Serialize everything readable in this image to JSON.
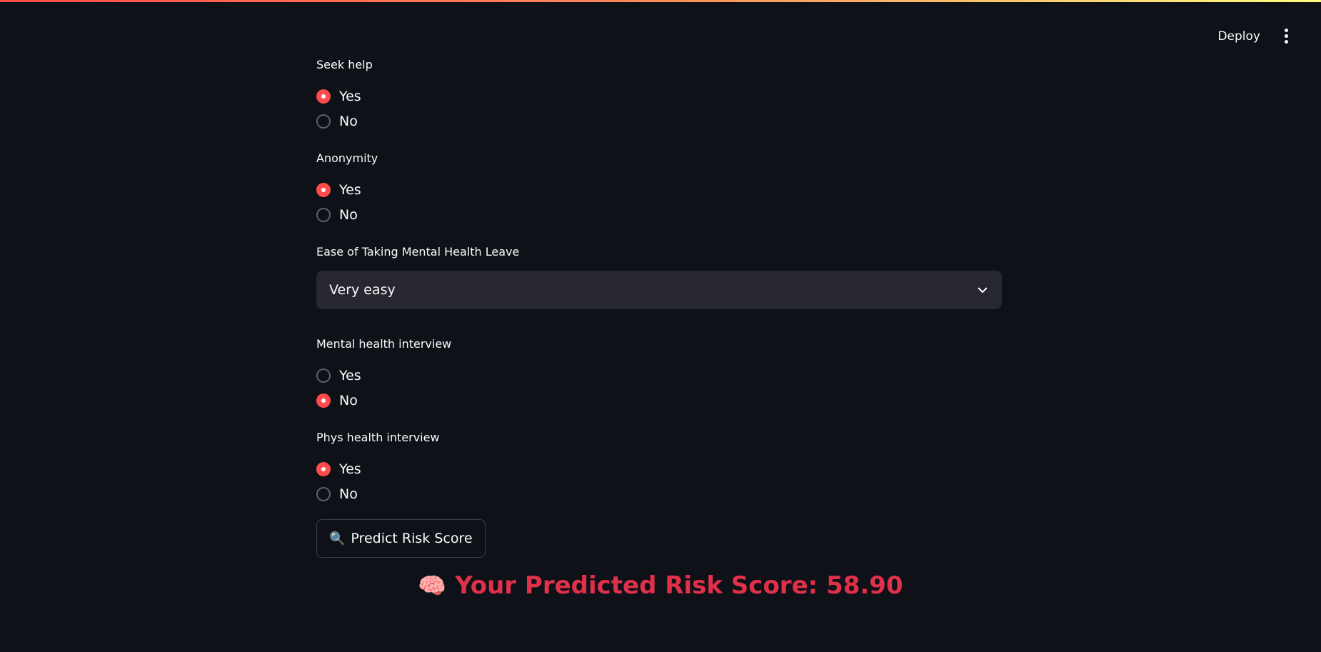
{
  "header": {
    "deploy_label": "Deploy",
    "menu_icon": "more-vertical-icon"
  },
  "fields": {
    "seek_help": {
      "label": "Seek help",
      "options": [
        "Yes",
        "No"
      ],
      "selected": "Yes"
    },
    "anonymity": {
      "label": "Anonymity",
      "options": [
        "Yes",
        "No"
      ],
      "selected": "Yes"
    },
    "leave": {
      "label": "Ease of Taking Mental Health Leave",
      "value": "Very easy"
    },
    "mental_interview": {
      "label": "Mental health interview",
      "options": [
        "Yes",
        "No"
      ],
      "selected": "No"
    },
    "phys_interview": {
      "label": "Phys health interview",
      "options": [
        "Yes",
        "No"
      ],
      "selected": "Yes"
    }
  },
  "predict_button": {
    "icon": "🔍",
    "label": "Predict Risk Score"
  },
  "result": {
    "icon": "🧠",
    "text": "Your Predicted Risk Score: 58.90"
  },
  "colors": {
    "accent": "#ff4b4b",
    "result": "#e0304a",
    "background": "#0e1117",
    "input_bg": "#262730"
  }
}
